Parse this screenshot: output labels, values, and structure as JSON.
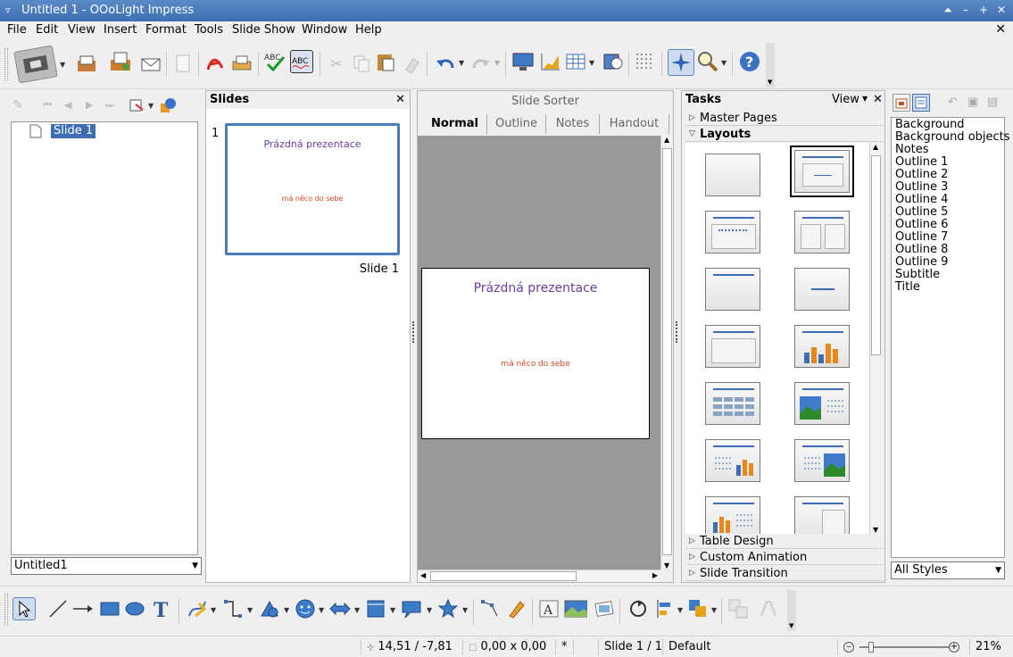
{
  "window": {
    "title": "Untitled 1 - OOoLight Impress",
    "menu_glyph": "▿",
    "buttons": [
      "⏶",
      "–",
      "+",
      "✕"
    ]
  },
  "menubar": {
    "items": [
      "File",
      "Edit",
      "View",
      "Insert",
      "Format",
      "Tools",
      "Slide Show",
      "Window",
      "Help"
    ],
    "close": "✕"
  },
  "navigator": {
    "tree_item": "Slide 1",
    "document_select": "Untitled1"
  },
  "slides_pane": {
    "title": "Slides",
    "close": "✕",
    "thumbnail_number": "1",
    "thumbnail_label": "Slide 1"
  },
  "view": {
    "title_label": "Slide Sorter",
    "tabs": [
      "Normal",
      "Outline",
      "Notes",
      "Handout"
    ],
    "active_tab": "Normal"
  },
  "slide": {
    "title": "Prázdná prezentace",
    "subtitle": "má něco do sebe",
    "title_color": "#6a3ea0",
    "subtitle_color": "#d2451e"
  },
  "tasks": {
    "title": "Tasks",
    "view_label": "View",
    "close": "✕",
    "sections_top": [
      "Master Pages",
      "Layouts"
    ],
    "sections_bottom": [
      "Table Design",
      "Custom Animation",
      "Slide Transition"
    ]
  },
  "styles": {
    "items": [
      "Background",
      "Background objects",
      "Notes",
      "Outline 1",
      "Outline 2",
      "Outline 3",
      "Outline 4",
      "Outline 5",
      "Outline 6",
      "Outline 7",
      "Outline 8",
      "Outline 9",
      "Subtitle",
      "Title"
    ],
    "filter": "All Styles"
  },
  "statusbar": {
    "position": "14,51 / -7,81",
    "size": "0,00 x 0,00",
    "modified": "*",
    "slide": "Slide 1 / 1",
    "master": "Default",
    "zoom": "21%"
  },
  "colors": {
    "titlebar": "#4a7abc",
    "selection": "#3d6eb5",
    "accent_blue": "#2f63b8"
  }
}
